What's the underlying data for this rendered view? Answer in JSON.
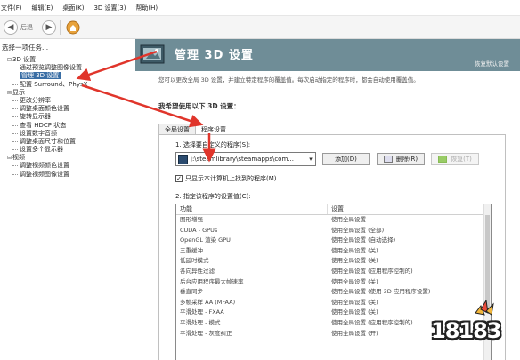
{
  "menu": [
    "文件(F)",
    "编辑(E)",
    "桌面(K)",
    "3D 设置(3)",
    "帮助(H)"
  ],
  "toolbar": {
    "back_label": "后退",
    "home": "home-icon"
  },
  "sidebar": {
    "title": "选择一项任务...",
    "tree": [
      {
        "level": 1,
        "toggle": "⊟",
        "label": "3D 设置"
      },
      {
        "level": 2,
        "label": "通过预览调整图像设置"
      },
      {
        "level": 2,
        "label": "管理 3D 设置",
        "selected": true
      },
      {
        "level": 2,
        "label": "配置 Surround、PhysX"
      },
      {
        "level": 1,
        "toggle": "⊟",
        "label": "显示"
      },
      {
        "level": 2,
        "label": "更改分辨率"
      },
      {
        "level": 2,
        "label": "调整桌面颜色设置"
      },
      {
        "level": 2,
        "label": "旋转显示器"
      },
      {
        "level": 2,
        "label": "查看 HDCP 状态"
      },
      {
        "level": 2,
        "label": "设置数字音频"
      },
      {
        "level": 2,
        "label": "调整桌面尺寸和位置"
      },
      {
        "level": 2,
        "label": "设置多个显示器"
      },
      {
        "level": 1,
        "toggle": "⊟",
        "label": "视频"
      },
      {
        "level": 2,
        "label": "调整视频颜色设置"
      },
      {
        "level": 2,
        "label": "调整视频图像设置"
      }
    ]
  },
  "main": {
    "title": "管理 3D 设置",
    "description": "您可以更改全局 3D 设置，并建立特定程序的覆盖值。每次启动指定的程序时，都会自动使用覆盖值。",
    "restore": "恢复默认设置",
    "section_title": "我希望使用以下 3D 设置：",
    "tabs": [
      "全局设置",
      "程序设置"
    ],
    "program_label": "1. 选择要自定义的程序(S):",
    "program_value": "j:\\steamlibrary\\steamapps\\com...",
    "add_button": "添加(D)",
    "remove_button": "删除(R)",
    "restore_button": "恢复(T)",
    "checkbox_label": "只显示本计算机上找到的程序(M)",
    "settings_label": "2. 指定该程序的设置值(C):",
    "columns": [
      "功能",
      "设置"
    ],
    "rows": [
      [
        "图形增强",
        "使用全局设置"
      ],
      [
        "CUDA - GPUs",
        "使用全局设置 (全部)"
      ],
      [
        "OpenGL 渲染 GPU",
        "使用全局设置 (自动选择)"
      ],
      [
        "三重缓冲",
        "使用全局设置 (关)"
      ],
      [
        "低延时模式",
        "使用全局设置 (关)"
      ],
      [
        "各向异性过滤",
        "使用全局设置 (应用程序控制的)"
      ],
      [
        "后台应用程序最大帧速率",
        "使用全局设置 (关)"
      ],
      [
        "垂直同步",
        "使用全局设置 (使用 3D 应用程序设置)"
      ],
      [
        "多帧采样 AA (MFAA)",
        "使用全局设置 (关)"
      ],
      [
        "平滑处理 - FXAA",
        "使用全局设置 (关)"
      ],
      [
        "平滑处理 - 模式",
        "使用全局设置 (应用程序控制的)"
      ],
      [
        "平滑处理 - 灰度纠正",
        "使用全局设置 (开)"
      ]
    ]
  },
  "watermark": "18183",
  "colors": {
    "accent": "#6f8d97",
    "selected": "#3a6ea5",
    "arrow": "#e0352b"
  }
}
